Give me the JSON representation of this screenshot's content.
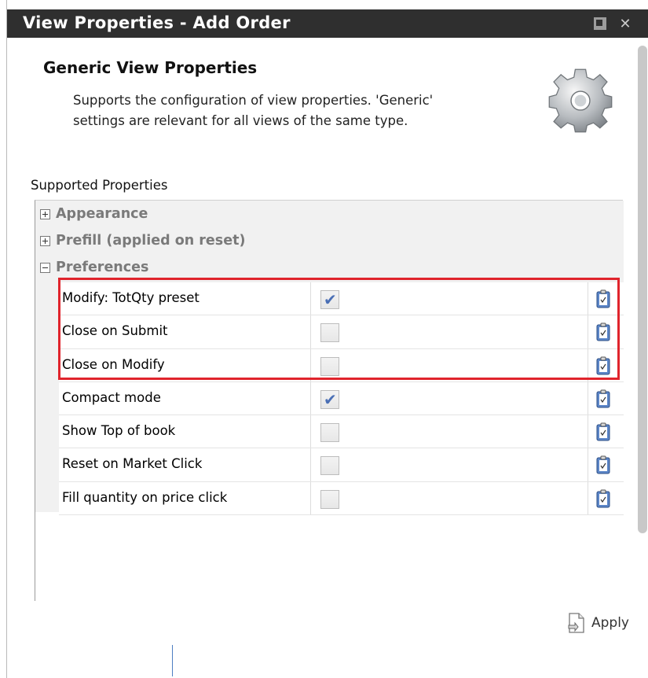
{
  "window": {
    "title": "View Properties - Add Order",
    "restore_icon": "restore-window-icon",
    "close_icon": "close-x-icon"
  },
  "header": {
    "title": "Generic View Properties",
    "description": "Supports the configuration of view properties. 'Generic' settings are relevant for all views of the same type.",
    "icon": "gear-icon"
  },
  "section_label": "Supported Properties",
  "groups": [
    {
      "label": "Appearance",
      "expanded": false
    },
    {
      "label": "Prefill (applied on reset)",
      "expanded": false
    },
    {
      "label": "Preferences",
      "expanded": true
    }
  ],
  "properties": [
    {
      "name": "Modify: TotQty preset",
      "checked": true,
      "highlighted": true
    },
    {
      "name": "Close on Submit",
      "checked": false,
      "highlighted": true
    },
    {
      "name": "Close on Modify",
      "checked": false,
      "highlighted": true
    },
    {
      "name": "Compact mode",
      "checked": true,
      "highlighted": false
    },
    {
      "name": "Show Top of book",
      "checked": false,
      "highlighted": false
    },
    {
      "name": "Reset on Market Click",
      "checked": false,
      "highlighted": false
    },
    {
      "name": "Fill quantity on price click",
      "checked": false,
      "highlighted": false
    }
  ],
  "apply_button": {
    "label": "Apply",
    "icon": "apply-document-icon"
  },
  "colors": {
    "titlebar": "#2f2f2f",
    "highlight": "#e0242c",
    "checkmark": "#4a6fb5"
  }
}
